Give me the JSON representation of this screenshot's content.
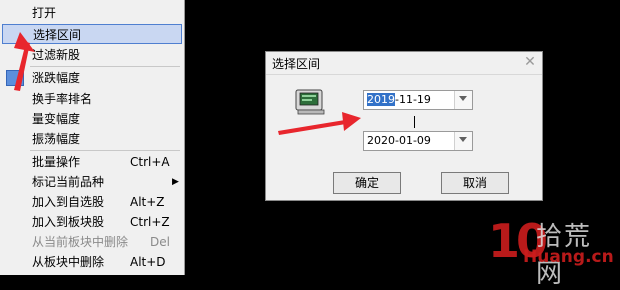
{
  "menu": {
    "items": [
      {
        "label": "打开",
        "shortcut": ""
      },
      {
        "label": "选择区间",
        "shortcut": ""
      },
      {
        "label": "过滤新股",
        "shortcut": ""
      },
      {
        "label": "涨跌幅度",
        "shortcut": ""
      },
      {
        "label": "换手率排名",
        "shortcut": ""
      },
      {
        "label": "量变幅度",
        "shortcut": ""
      },
      {
        "label": "振荡幅度",
        "shortcut": ""
      },
      {
        "label": "批量操作",
        "shortcut": "Ctrl+A"
      },
      {
        "label": "标记当前品种",
        "shortcut": ""
      },
      {
        "label": "加入到自选股",
        "shortcut": "Alt+Z"
      },
      {
        "label": "加入到板块股",
        "shortcut": "Ctrl+Z"
      },
      {
        "label": "从当前板块中删除",
        "shortcut": "Del"
      },
      {
        "label": "从板块中删除",
        "shortcut": "Alt+D"
      }
    ]
  },
  "dialog": {
    "title": "选择区间",
    "start_date_selected": "2019",
    "start_date_rest": "-11-19",
    "end_date": "2020-01-09",
    "ok_label": "确定",
    "cancel_label": "取消"
  },
  "watermark": {
    "logo_number": "10",
    "logo_text": "拾荒网",
    "url": "Huang.cn"
  },
  "colors": {
    "accent_arrow": "#e8262d",
    "selection": "#3372c8"
  }
}
